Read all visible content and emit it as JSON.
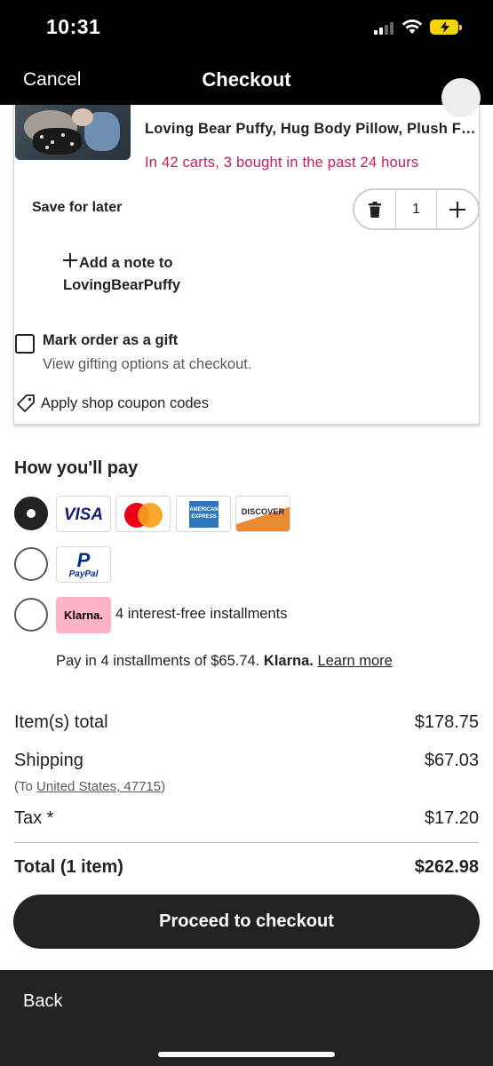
{
  "status_bar": {
    "time": "10:31"
  },
  "nav": {
    "cancel": "Cancel",
    "title": "Checkout"
  },
  "item": {
    "title": "Loving Bear Puffy, Hug Body Pillow, Plush Fi...",
    "scarcity": "In 42 carts, 3 bought in the past 24 hours",
    "save_for_later": "Save for later",
    "quantity": "1",
    "note_line1": "Add a note to",
    "note_line2": "LovingBearPuffy",
    "gift_label": "Mark order as a gift",
    "gift_sub": "View gifting options at checkout.",
    "coupon": "Apply shop coupon codes"
  },
  "payment": {
    "heading": "How you'll pay",
    "selected": "cards",
    "cards": {
      "visa": "VISA",
      "amex": "AMERICAN EXPRESS",
      "discover": "DISCOVER"
    },
    "paypal": {
      "letter": "P",
      "label": "PayPal"
    },
    "klarna": {
      "logo": "Klarna.",
      "desc": "4 interest-free installments",
      "line_prefix": "Pay in 4 installments of $65.74.",
      "line_brand": "Klarna.",
      "learn_more": "Learn more"
    }
  },
  "totals": {
    "items_label": "Item(s) total",
    "items_value": "$178.75",
    "shipping_label": "Shipping",
    "shipping_value": "$67.03",
    "ship_to_prefix": "(To ",
    "ship_to_link": "United States, 47715",
    "ship_to_suffix": ")",
    "tax_label": "Tax *",
    "tax_value": "$17.20",
    "total_label": "Total (1 item)",
    "total_value": "$262.98"
  },
  "checkout_button": "Proceed to checkout",
  "bottom_bar": {
    "back": "Back"
  },
  "colors": {
    "scarcity": "#c41f54",
    "button": "#222222",
    "klarna": "#ffb3c7"
  }
}
